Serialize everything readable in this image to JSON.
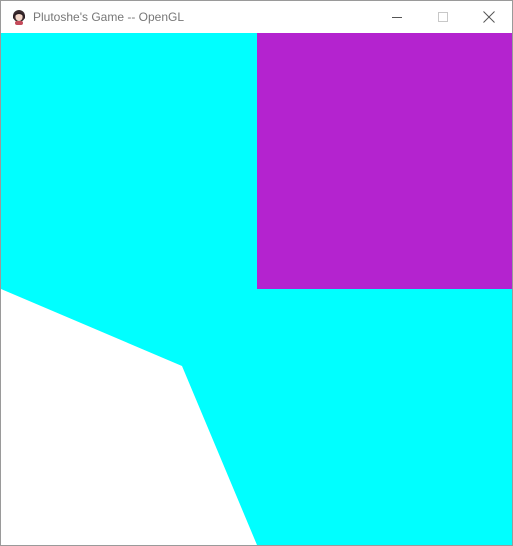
{
  "window": {
    "title": "Plutoshe's Game -- OpenGL",
    "icon": "app-avatar-icon",
    "controls": [
      "minimize-icon",
      "maximize-icon",
      "close-icon"
    ]
  },
  "scene": {
    "colors": {
      "background": "#00ffff",
      "square": "#b423cf",
      "void": "#ffffff"
    }
  }
}
